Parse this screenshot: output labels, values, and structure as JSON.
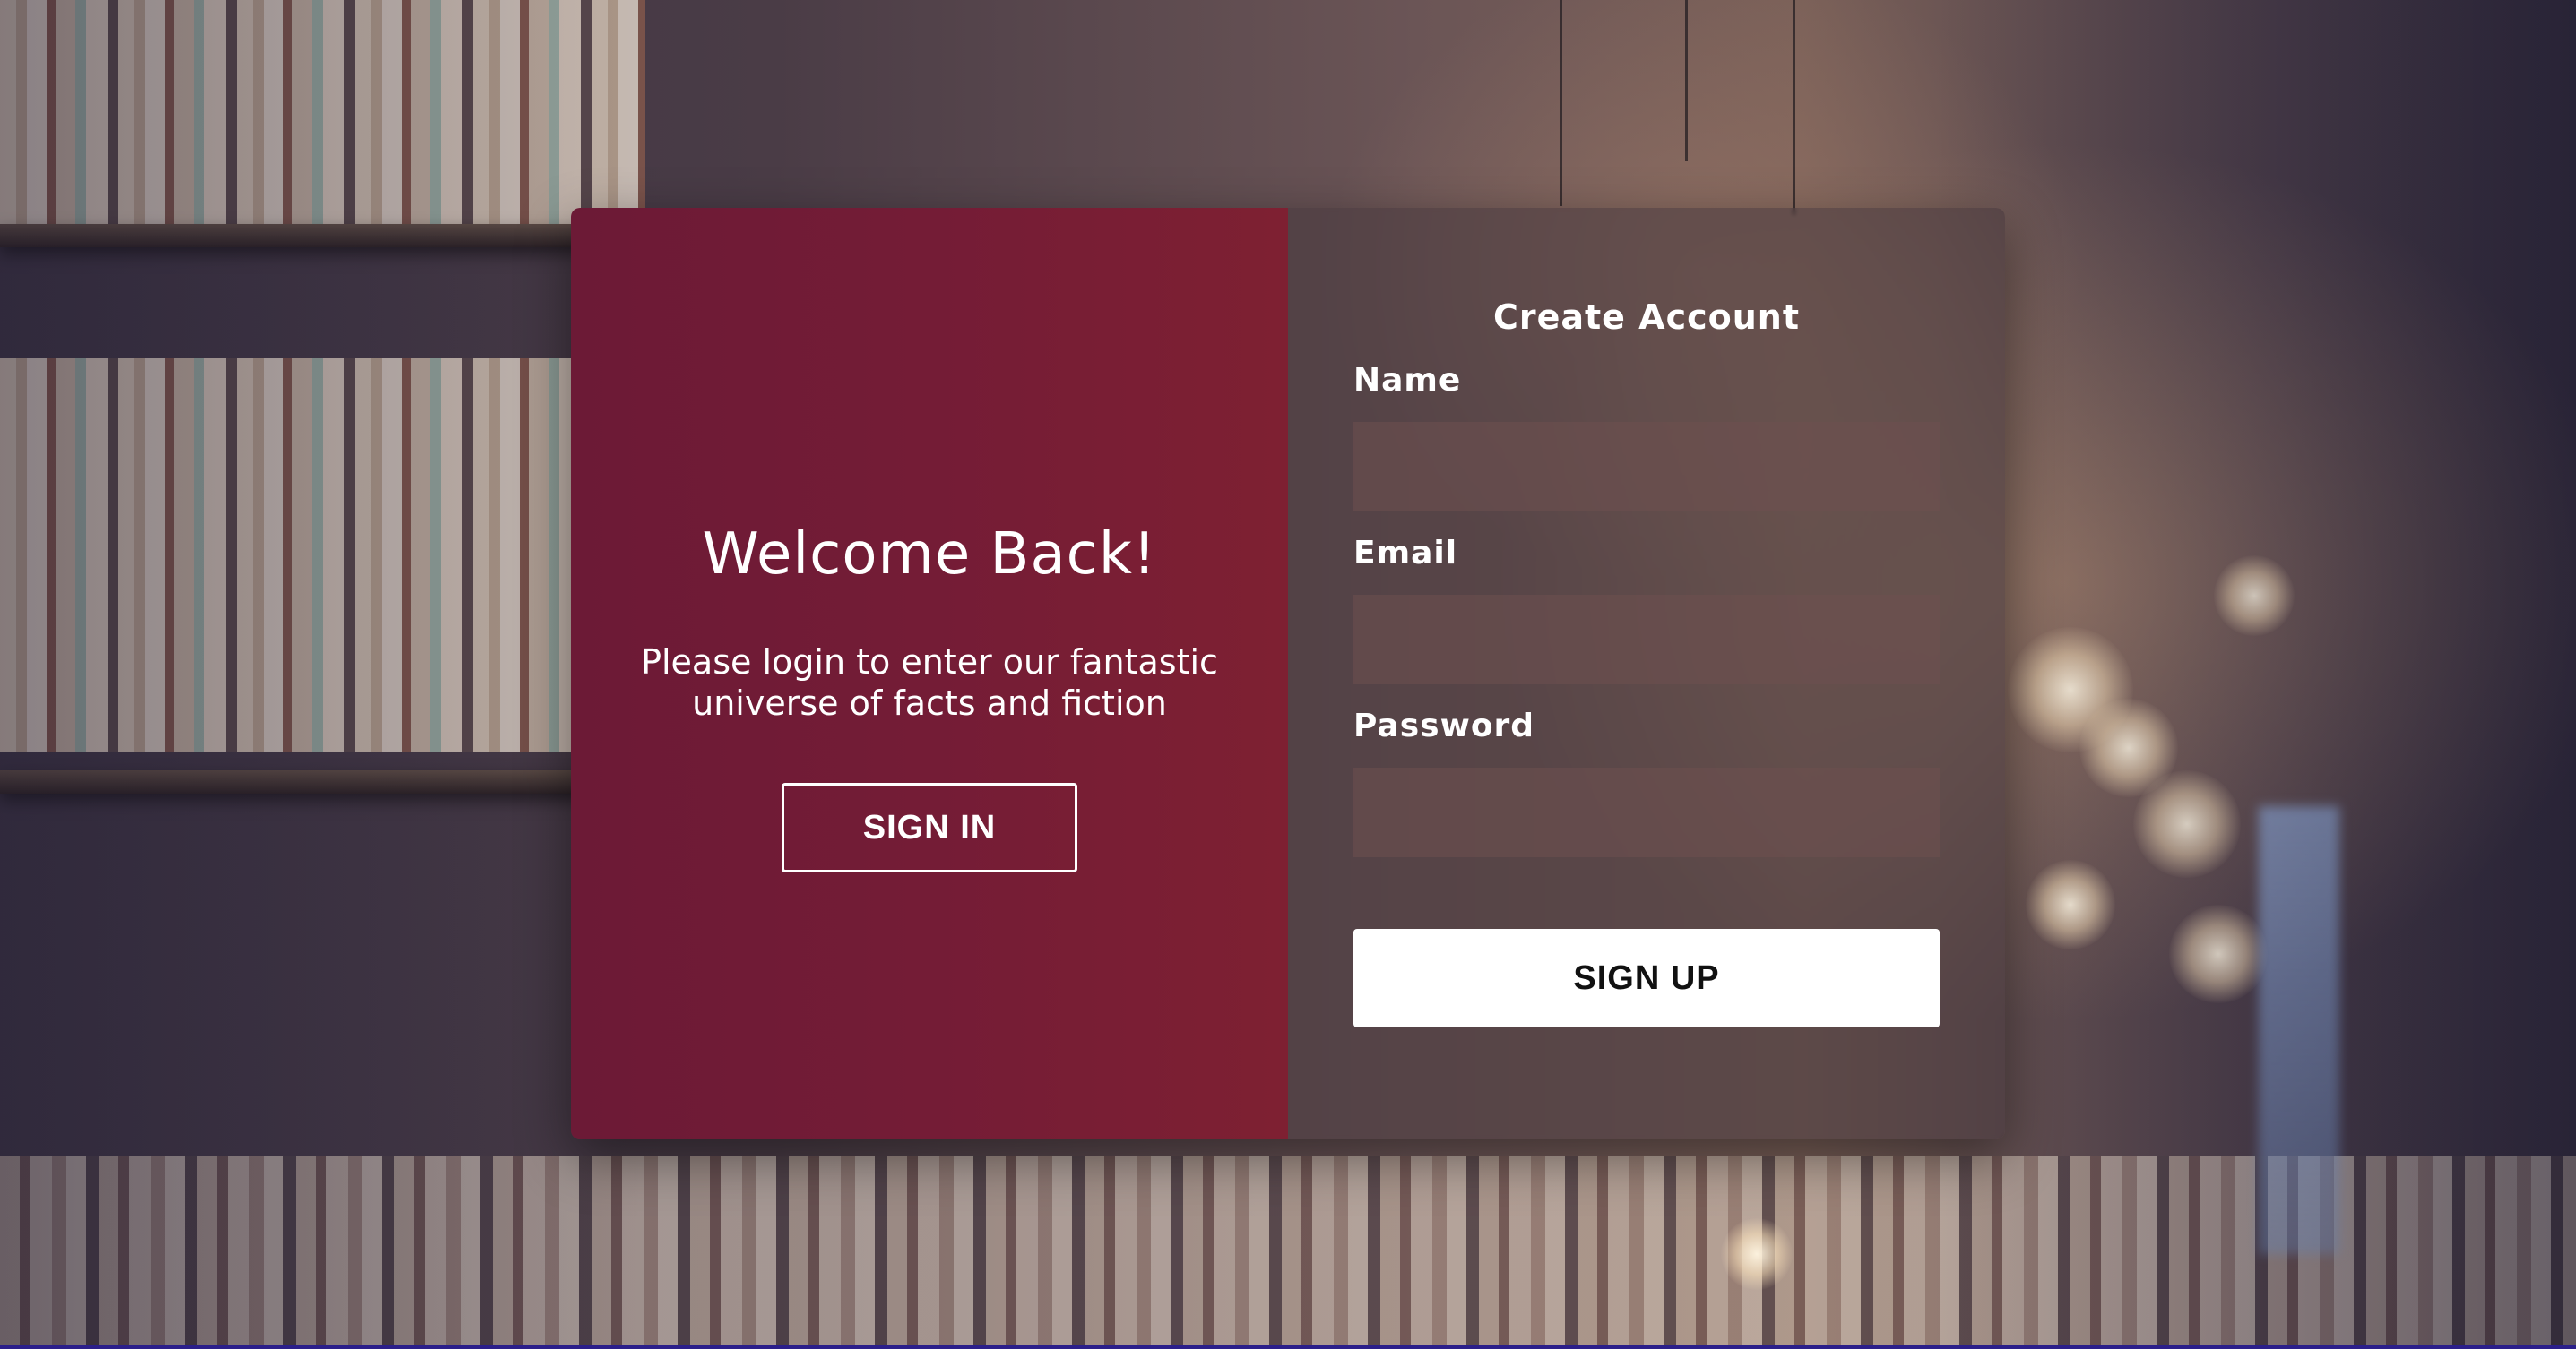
{
  "colors": {
    "accent_left_panel": "#741c36",
    "form_panel_overlay": "#463739",
    "signup_button_bg": "#ffffff",
    "text": "#ffffff"
  },
  "welcome": {
    "title": "Welcome Back!",
    "text": "Please login to enter our fantastic universe of facts and fiction",
    "signin_label": "SIGN IN"
  },
  "signup_form": {
    "title": "Create Account",
    "fields": [
      {
        "label": "Name",
        "value": "",
        "placeholder": ""
      },
      {
        "label": "Email",
        "value": "",
        "placeholder": ""
      },
      {
        "label": "Password",
        "value": "",
        "placeholder": ""
      }
    ],
    "submit_label": "SIGN UP"
  }
}
